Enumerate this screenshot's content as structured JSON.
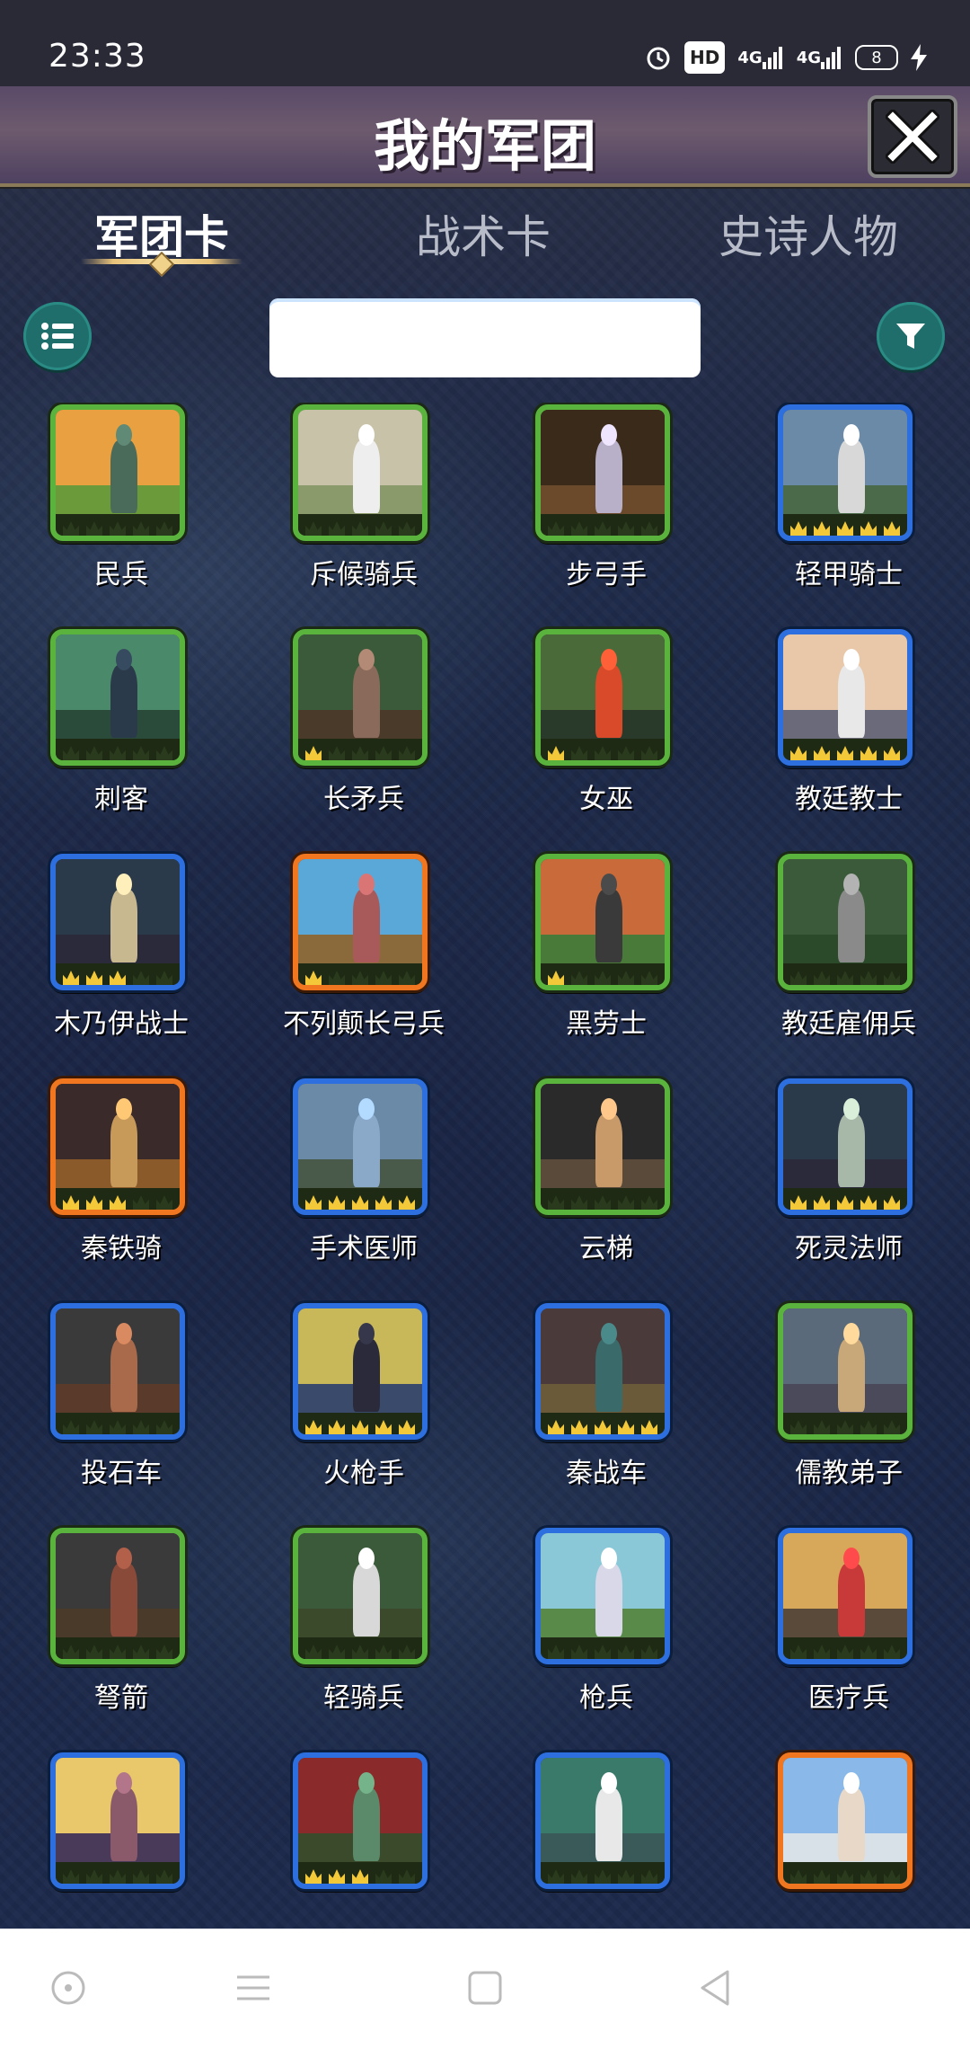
{
  "status_bar": {
    "time": "23:33",
    "hd_label": "HD",
    "signal1": "4G",
    "signal2": "4G",
    "battery": "8"
  },
  "header": {
    "title": "我的军团"
  },
  "tabs": [
    {
      "label": "军团卡",
      "active": true
    },
    {
      "label": "战术卡",
      "active": false
    },
    {
      "label": "史诗人物",
      "active": false
    }
  ],
  "search": {
    "value": "",
    "placeholder": ""
  },
  "colors": {
    "green": "#5ab33c",
    "blue": "#2e6fe0",
    "orange": "#f0761f",
    "teal": "#1f6e6b"
  },
  "cards": [
    {
      "name": "民兵",
      "rarity": "green",
      "stars": 0,
      "sky": "#e8a040",
      "ground": "#6a9a3a",
      "fig": "#4a6a5a"
    },
    {
      "name": "斥候骑兵",
      "rarity": "green",
      "stars": 0,
      "sky": "#c8c2a8",
      "ground": "#8a9a6a",
      "fig": "#eeeeee"
    },
    {
      "name": "步弓手",
      "rarity": "green",
      "stars": 0,
      "sky": "#3a2a1a",
      "ground": "#6a4a2a",
      "fig": "#b8b0c8"
    },
    {
      "name": "轻甲骑士",
      "rarity": "blue",
      "stars": 5,
      "sky": "#6a8aa8",
      "ground": "#4a6a4a",
      "fig": "#d8d8d8"
    },
    {
      "name": "刺客",
      "rarity": "green",
      "stars": 0,
      "sky": "#4a8a6a",
      "ground": "#2a4a3a",
      "fig": "#2a3a4a"
    },
    {
      "name": "长矛兵",
      "rarity": "green",
      "stars": 1,
      "sky": "#3a5a3a",
      "ground": "#4a3a2a",
      "fig": "#8a6a5a"
    },
    {
      "name": "女巫",
      "rarity": "green",
      "stars": 1,
      "sky": "#4a6a3a",
      "ground": "#2a3a2a",
      "fig": "#d84a2a"
    },
    {
      "name": "教廷教士",
      "rarity": "blue",
      "stars": 5,
      "sky": "#e8c8a8",
      "ground": "#6a6a7a",
      "fig": "#e8e8e8"
    },
    {
      "name": "木乃伊战士",
      "rarity": "blue",
      "stars": 3,
      "sky": "#2a3a4a",
      "ground": "#2a2a3a",
      "fig": "#c8b890"
    },
    {
      "name": "不列颠长弓兵",
      "rarity": "orange",
      "stars": 1,
      "sky": "#5aa8d8",
      "ground": "#8a6a3a",
      "fig": "#a85a5a"
    },
    {
      "name": "黑劳士",
      "rarity": "green",
      "stars": 1,
      "sky": "#c86a3a",
      "ground": "#4a7a3a",
      "fig": "#3a3a3a"
    },
    {
      "name": "教廷雇佣兵",
      "rarity": "green",
      "stars": 0,
      "sky": "#3a5a3a",
      "ground": "#2a4a2a",
      "fig": "#8a8a8a"
    },
    {
      "name": "秦铁骑",
      "rarity": "orange",
      "stars": 3,
      "sky": "#3a2a2a",
      "ground": "#8a5a2a",
      "fig": "#c89a5a"
    },
    {
      "name": "手术医师",
      "rarity": "blue",
      "stars": 5,
      "sky": "#6a8aa8",
      "ground": "#4a5a4a",
      "fig": "#8aa8c8"
    },
    {
      "name": "云梯",
      "rarity": "green",
      "stars": 0,
      "sky": "#2a2a2a",
      "ground": "#5a4a3a",
      "fig": "#c89a6a"
    },
    {
      "name": "死灵法师",
      "rarity": "blue",
      "stars": 5,
      "sky": "#2a3a4a",
      "ground": "#2a2a3a",
      "fig": "#a8b8a8"
    },
    {
      "name": "投石车",
      "rarity": "blue",
      "stars": 0,
      "sky": "#3a3a3a",
      "ground": "#5a3a2a",
      "fig": "#a86a4a"
    },
    {
      "name": "火枪手",
      "rarity": "blue",
      "stars": 5,
      "sky": "#c8b85a",
      "ground": "#3a4a6a",
      "fig": "#2a2a3a"
    },
    {
      "name": "秦战车",
      "rarity": "blue",
      "stars": 5,
      "sky": "#4a3a3a",
      "ground": "#6a5a3a",
      "fig": "#3a6a6a"
    },
    {
      "name": "儒教弟子",
      "rarity": "green",
      "stars": 0,
      "sky": "#5a6a7a",
      "ground": "#4a4a5a",
      "fig": "#c8a878"
    },
    {
      "name": "弩箭",
      "rarity": "green",
      "stars": 0,
      "sky": "#3a3a3a",
      "ground": "#4a3a2a",
      "fig": "#8a4a3a"
    },
    {
      "name": "轻骑兵",
      "rarity": "green",
      "stars": 0,
      "sky": "#3a5a3a",
      "ground": "#3a4a2a",
      "fig": "#d8d8d8"
    },
    {
      "name": "枪兵",
      "rarity": "blue",
      "stars": 0,
      "sky": "#8ac8d8",
      "ground": "#5a8a4a",
      "fig": "#d8d8e8"
    },
    {
      "name": "医疗兵",
      "rarity": "blue",
      "stars": 0,
      "sky": "#d8a85a",
      "ground": "#5a4a3a",
      "fig": "#c83a3a"
    },
    {
      "name": "",
      "rarity": "blue",
      "stars": 0,
      "sky": "#e8c86a",
      "ground": "#4a3a5a",
      "fig": "#8a5a6a"
    },
    {
      "name": "",
      "rarity": "blue",
      "stars": 3,
      "sky": "#8a2a2a",
      "ground": "#3a4a2a",
      "fig": "#5a8a6a"
    },
    {
      "name": "",
      "rarity": "blue",
      "stars": 0,
      "sky": "#3a7a6a",
      "ground": "#3a5a5a",
      "fig": "#e8e8e8"
    },
    {
      "name": "",
      "rarity": "orange",
      "stars": 0,
      "sky": "#8ab8e8",
      "ground": "#d8e0e8",
      "fig": "#e8d8c8"
    }
  ],
  "nav": [
    {
      "name": "home-nav-button",
      "icon": "circle-dot-icon"
    },
    {
      "name": "menu-nav-button",
      "icon": "hamburger-icon"
    },
    {
      "name": "recents-nav-button",
      "icon": "square-icon"
    },
    {
      "name": "back-nav-button",
      "icon": "triangle-back-icon"
    }
  ]
}
